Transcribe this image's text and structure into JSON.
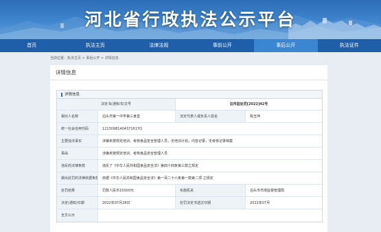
{
  "header": {
    "title": "河北省行政执法公示平台"
  },
  "nav": {
    "items": [
      {
        "label": "首页",
        "active": false
      },
      {
        "label": "执法主页",
        "active": false
      },
      {
        "label": "法律法规",
        "active": false
      },
      {
        "label": "事前公开",
        "active": false
      },
      {
        "label": "事后公开",
        "active": true
      },
      {
        "label": "执法证件",
        "active": false
      }
    ]
  },
  "breadcrumb": "当前位置：执法主页 > 事后公开 > 详情信息",
  "panel": {
    "title": "详情信息",
    "section_title": "详情信息"
  },
  "detail": {
    "decision_no_label": "决定书(通知书)文号",
    "decision_no": "泊市监处罚[2022]42号",
    "party_name_label": "相对人名称",
    "party_name": "泊头市第一中学第三食堂",
    "legal_rep_label": "法定代表人或负责人姓名",
    "legal_rep": "陈玉萍",
    "credit_code_label": "统一社会信用代码",
    "credit_code": "12130981404371617Q",
    "facts_label": "主要违法事实",
    "facts": "涉嫌未按规定培训、考核食品安全管理人员，无培训计划，内容记录，无考核记录档案",
    "cause_label": "事由",
    "cause": "涉嫌未按规定培训、考核食品安全管理人员",
    "violated_label": "违反的法律条款",
    "violated": "违反了《中华人民共和国食品安全法》第四十四条第三款之规定",
    "basis_label": "做出处罚的法律依据条款",
    "basis": "依据《中华人民共和国食品安全法》第一百二十六条第一款第二项 之规定",
    "result_label": "处罚结果",
    "result": "罚款人民币15000元",
    "authority_label": "实施机关",
    "authority": "泊头市市场监督管理局",
    "decision_date_label": "决定(通知)日期",
    "decision_date": "2022年07月28日",
    "delivery_date_label": "处罚决定书送达日期",
    "delivery_date": "2022年07月",
    "public_label": "全文公示",
    "public_value": ""
  }
}
